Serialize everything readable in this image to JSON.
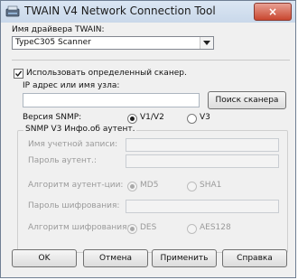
{
  "window": {
    "title": "TWAIN V4 Network Connection Tool",
    "close_glyph": "×"
  },
  "driver": {
    "label": "Имя драйвера TWAIN:",
    "selected": "TypeC305 Scanner"
  },
  "specific_scanner": {
    "label": "Использовать определенный сканер.",
    "checked": true
  },
  "ip": {
    "label": "IP адрес или имя узла:",
    "value": "",
    "search_button": "Поиск сканера"
  },
  "snmp": {
    "label": "Версия SNMP:",
    "options": [
      "V1/V2",
      "V3"
    ],
    "selected": "V1/V2"
  },
  "snmp_v3": {
    "legend": "SNMP V3 Инфо.об аутент.",
    "account_label": "Имя учетной записи:",
    "auth_password_label": "Пароль аутент.:",
    "auth_algorithm_label": "Алгоритм аутент-ции:",
    "auth_algorithm_options": [
      "MD5",
      "SHA1"
    ],
    "encryption_password_label": "Пароль шифрования:",
    "encryption_algorithm_label": "Алгоритм шифрования:",
    "encryption_algorithm_options": [
      "DES",
      "AES128"
    ]
  },
  "buttons": {
    "ok": "OK",
    "cancel": "Отмена",
    "apply": "Применить",
    "help": "Справка"
  },
  "colors": {
    "title_gradient_top": "#dbe6f3",
    "close_red": "#c9462f",
    "dialog_bg": "#f0f0f0"
  }
}
